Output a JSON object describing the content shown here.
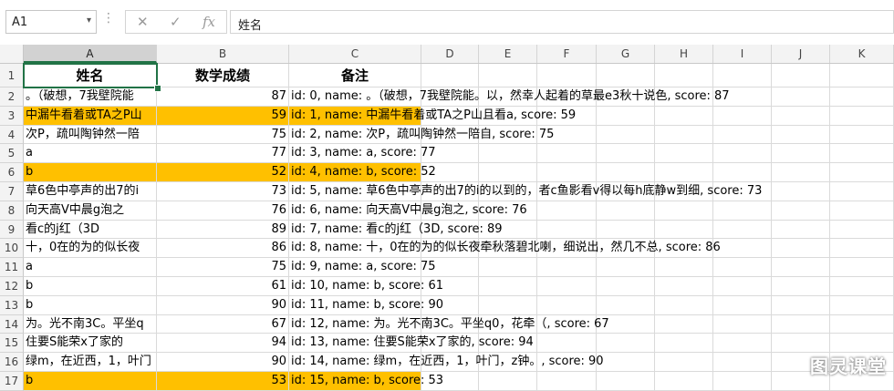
{
  "formula_bar": {
    "name_box": "A1",
    "fx_symbol": "fx",
    "formula": "姓名"
  },
  "columns": [
    "A",
    "B",
    "C",
    "D",
    "E",
    "F",
    "G",
    "H",
    "I",
    "J",
    "K"
  ],
  "header_row": {
    "row_num": "1",
    "name": "姓名",
    "score": "数学成绩",
    "note": "备注"
  },
  "rows": [
    {
      "row_num": "2",
      "name": "。（破想，7我壁院能",
      "score": "87",
      "note": "id: 0, name: 。（破想，7我壁院能。以，然幸人起着的草最e3秋十说色, score: 87",
      "highlight": false
    },
    {
      "row_num": "3",
      "name": "中漏牛看着或TA之P山",
      "score": "59",
      "note": "id: 1, name: 中漏牛看着或TA之P山且看a, score: 59",
      "highlight": true
    },
    {
      "row_num": "4",
      "name": "次P，疏叫陶钟然一陪",
      "score": "75",
      "note": "id: 2, name: 次P，疏叫陶钟然一陪自, score: 75",
      "highlight": false
    },
    {
      "row_num": "5",
      "name": "a",
      "score": "77",
      "note": "id: 3, name: a, score: 77",
      "highlight": false
    },
    {
      "row_num": "6",
      "name": "b",
      "score": "52",
      "note": "id: 4, name: b, score: 52",
      "highlight": true
    },
    {
      "row_num": "7",
      "name": "草6色中亭声的出7的i",
      "score": "73",
      "note": "id: 5, name: 草6色中亭声的出7的i的以到的，者c鱼影看v得以每h底静w到细, score: 73",
      "highlight": false
    },
    {
      "row_num": "8",
      "name": "向天高V中晨g泡之",
      "score": "76",
      "note": "id: 6, name: 向天高V中晨g泡之, score: 76",
      "highlight": false
    },
    {
      "row_num": "9",
      "name": "看c的j红（3D",
      "score": "89",
      "note": "id: 7, name: 看c的j红（3D, score: 89",
      "highlight": false
    },
    {
      "row_num": "10",
      "name": "十，0在的为的似长夜",
      "score": "86",
      "note": "id: 8, name: 十，0在的为的似长夜牵秋落碧北喇，细说出，然几不总, score: 86",
      "highlight": false
    },
    {
      "row_num": "11",
      "name": "a",
      "score": "75",
      "note": "id: 9, name: a, score: 75",
      "highlight": false
    },
    {
      "row_num": "12",
      "name": "b",
      "score": "61",
      "note": "id: 10, name: b, score: 61",
      "highlight": false
    },
    {
      "row_num": "13",
      "name": "b",
      "score": "90",
      "note": "id: 11, name: b, score: 90",
      "highlight": false
    },
    {
      "row_num": "14",
      "name": "为。光不南3C。平坐q",
      "score": "67",
      "note": "id: 12, name: 为。光不南3C。平坐q0，花牵（, score: 67",
      "highlight": false
    },
    {
      "row_num": "15",
      "name": "住要S能荣x了家的",
      "score": "94",
      "note": "id: 13, name: 住要S能荣x了家的, score: 94",
      "highlight": false
    },
    {
      "row_num": "16",
      "name": "绿m，在近西，1，叶门",
      "score": "90",
      "note": "id: 14, name: 绿m，在近西，1，叶门，z钟。, score: 90",
      "highlight": false
    },
    {
      "row_num": "17",
      "name": "b",
      "score": "53",
      "note": "id: 15, name: b, score: 53",
      "highlight": true
    }
  ],
  "watermark": "图灵课堂",
  "colors": {
    "highlight": "#ffc000",
    "selection": "#217346"
  }
}
